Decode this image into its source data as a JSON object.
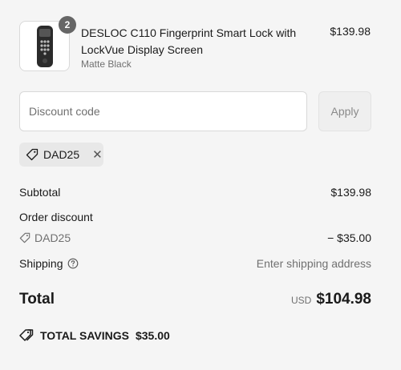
{
  "product": {
    "title": "DESLOC C110 Fingerprint Smart Lock with LockVue Display Screen",
    "variant": "Matte Black",
    "price": "$139.98",
    "quantity": "2",
    "image_icon": "smart-lock-product-image"
  },
  "discount": {
    "placeholder": "Discount code",
    "apply_label": "Apply",
    "applied_code": "DAD25"
  },
  "summary": {
    "subtotal_label": "Subtotal",
    "subtotal_value": "$139.98",
    "order_discount_label": "Order discount",
    "discount_code": "DAD25",
    "discount_value": "− $35.00",
    "shipping_label": "Shipping",
    "shipping_value": "Enter shipping address",
    "total_label": "Total",
    "currency": "USD",
    "total_value": "$104.98",
    "savings_label": "TOTAL SAVINGS",
    "savings_value": "$35.00"
  },
  "colors": {
    "background": "#f5f5f5",
    "badge": "#666666",
    "muted_text": "#707070",
    "chip": "#e8e8e8"
  }
}
